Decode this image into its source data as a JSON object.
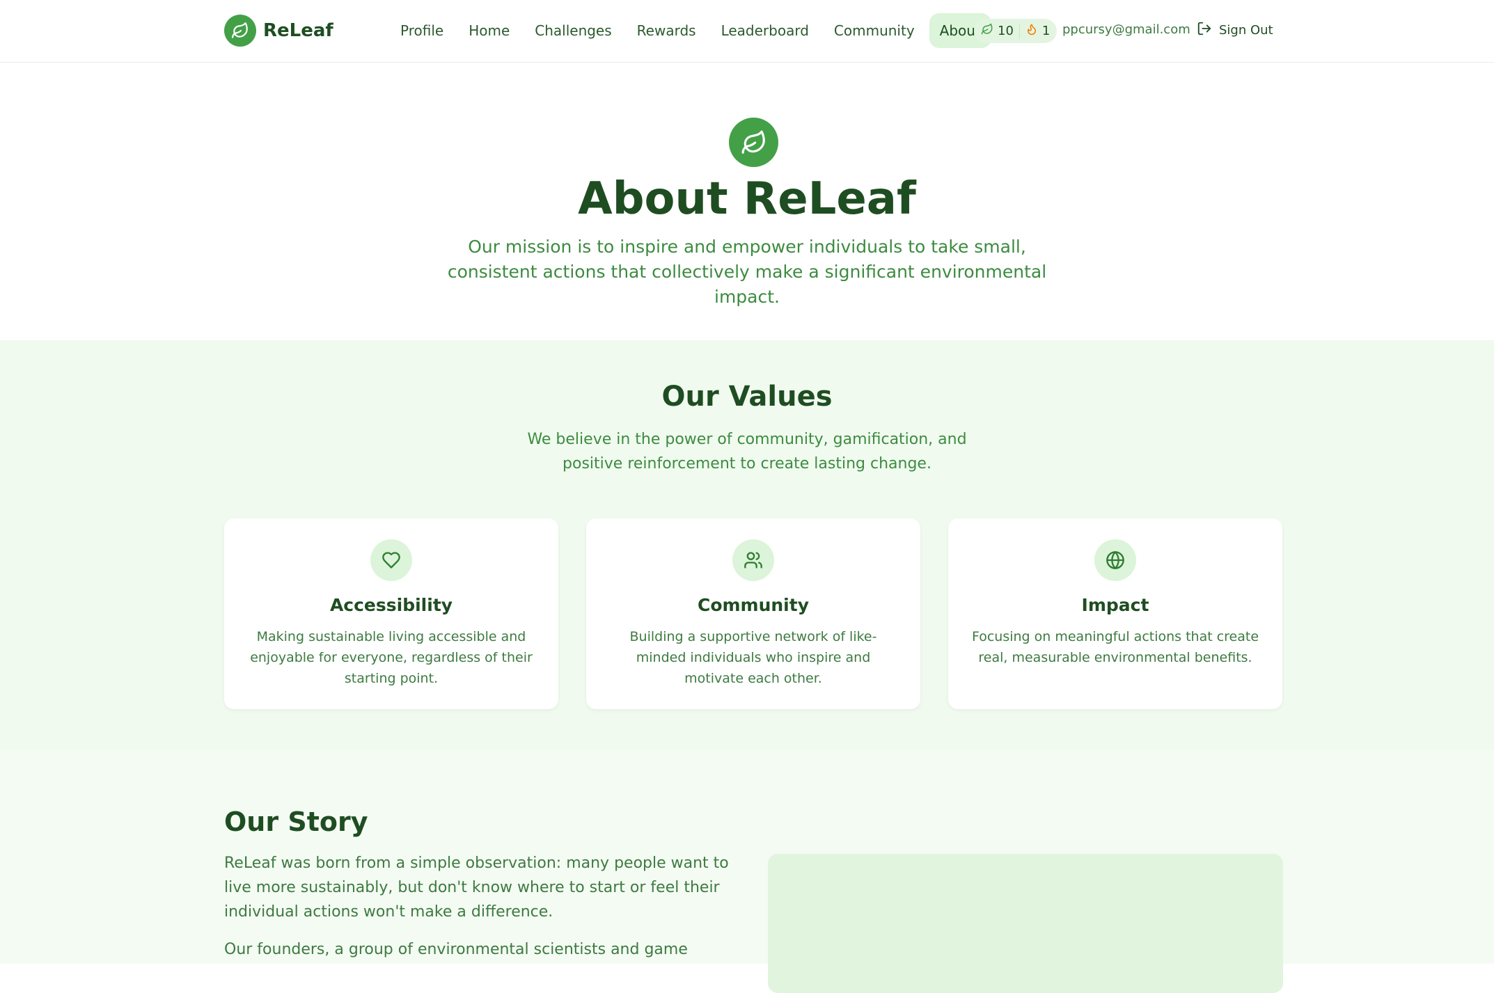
{
  "header": {
    "brand": "ReLeaf",
    "nav": [
      {
        "label": "Profile"
      },
      {
        "label": "Home"
      },
      {
        "label": "Challenges"
      },
      {
        "label": "Rewards"
      },
      {
        "label": "Leaderboard"
      },
      {
        "label": "Community"
      },
      {
        "label": "About"
      }
    ],
    "active_nav": "About",
    "stats": {
      "leaves": "10",
      "streak": "1"
    },
    "email": "ppcursy@gmail.com",
    "signout_label": "Sign Out"
  },
  "hero": {
    "title": "About ReLeaf",
    "subtitle": "Our mission is to inspire and empower individuals to take small, consistent actions that collectively make a significant environmental impact."
  },
  "values": {
    "title": "Our Values",
    "subtitle": "We believe in the power of community, gamification, and positive reinforcement to create lasting change.",
    "cards": [
      {
        "icon": "heart-icon",
        "title": "Accessibility",
        "text": "Making sustainable living accessible and enjoyable for everyone, regardless of their starting point."
      },
      {
        "icon": "users-icon",
        "title": "Community",
        "text": "Building a supportive network of like-minded individuals who inspire and motivate each other."
      },
      {
        "icon": "globe-icon",
        "title": "Impact",
        "text": "Focusing on meaningful actions that create real, measurable environmental benefits."
      }
    ]
  },
  "story": {
    "title": "Our Story",
    "paragraph1": "ReLeaf was born from a simple observation: many people want to live more sustainably, but don't know where to start or feel their individual actions won't make a difference.",
    "paragraph2": "Our founders, a group of environmental scientists and game"
  },
  "colors": {
    "primary": "#43a047",
    "dark_text": "#1f4d22",
    "accent_text": "#3d8b40",
    "values_bg": "#f0faef",
    "nav_active_bg": "#dcf4d9",
    "streak_flame": "#f57c00"
  }
}
